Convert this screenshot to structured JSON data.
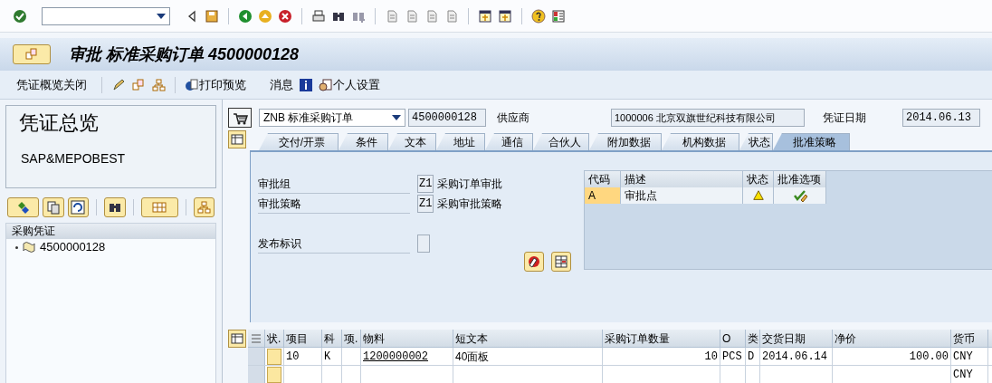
{
  "title": "审批 标准采购订单 4500000128",
  "app_toolbar": [
    "凭证概览关闭",
    "打印预览",
    "消息",
    "个人设置"
  ],
  "left_pane": {
    "title": "凭证总览",
    "subtitle": "SAP&MEPOBEST",
    "tree_header": "采购凭证",
    "tree": [
      {
        "label": "4500000128"
      }
    ]
  },
  "header": {
    "doc_type": "ZNB 标准采购订单",
    "doc_number": "4500000128",
    "vendor_label": "供应商",
    "vendor": "1000006 北京双旗世纪科技有限公司",
    "date_label": "凭证日期",
    "date": "2014.06.13"
  },
  "tabs": [
    {
      "label": "交付/开票",
      "selected": false
    },
    {
      "label": "条件",
      "selected": false
    },
    {
      "label": "文本",
      "selected": false
    },
    {
      "label": "地址",
      "selected": false
    },
    {
      "label": "通信",
      "selected": false
    },
    {
      "label": "合伙人",
      "selected": false
    },
    {
      "label": "附加数据",
      "selected": false
    },
    {
      "label": "机构数据",
      "selected": false
    },
    {
      "label": "状态",
      "selected": false
    },
    {
      "label": "批准策略",
      "selected": true
    }
  ],
  "release": {
    "fields": [
      {
        "label": "审批组",
        "code": "Z1",
        "text": "采购订单审批"
      },
      {
        "label": "审批策略",
        "code": "Z1",
        "text": "采购审批策略"
      }
    ],
    "indicator": {
      "label": "发布标识",
      "checked": false
    },
    "strategy_table": {
      "columns": [
        "代码",
        "描述",
        "状态",
        "批准选项"
      ],
      "rows": [
        {
          "code": "A",
          "description": "审批点",
          "kind": "warning",
          "selected": true
        }
      ]
    }
  },
  "items": {
    "columns": [
      "状.",
      "项目",
      "科",
      "项.",
      "物料",
      "短文本",
      "采购订单数量",
      "O",
      "类",
      "交货日期",
      "净价",
      "货币"
    ],
    "rows": [
      {
        "cells": [
          null,
          "10",
          "K",
          null,
          "1200000002",
          "40面板",
          "10",
          "PCS",
          "D",
          "2014.06.14",
          "100.00",
          "CNY"
        ]
      },
      {
        "cells": [
          null,
          null,
          null,
          null,
          null,
          null,
          null,
          null,
          null,
          null,
          null,
          "CNY"
        ]
      }
    ]
  }
}
